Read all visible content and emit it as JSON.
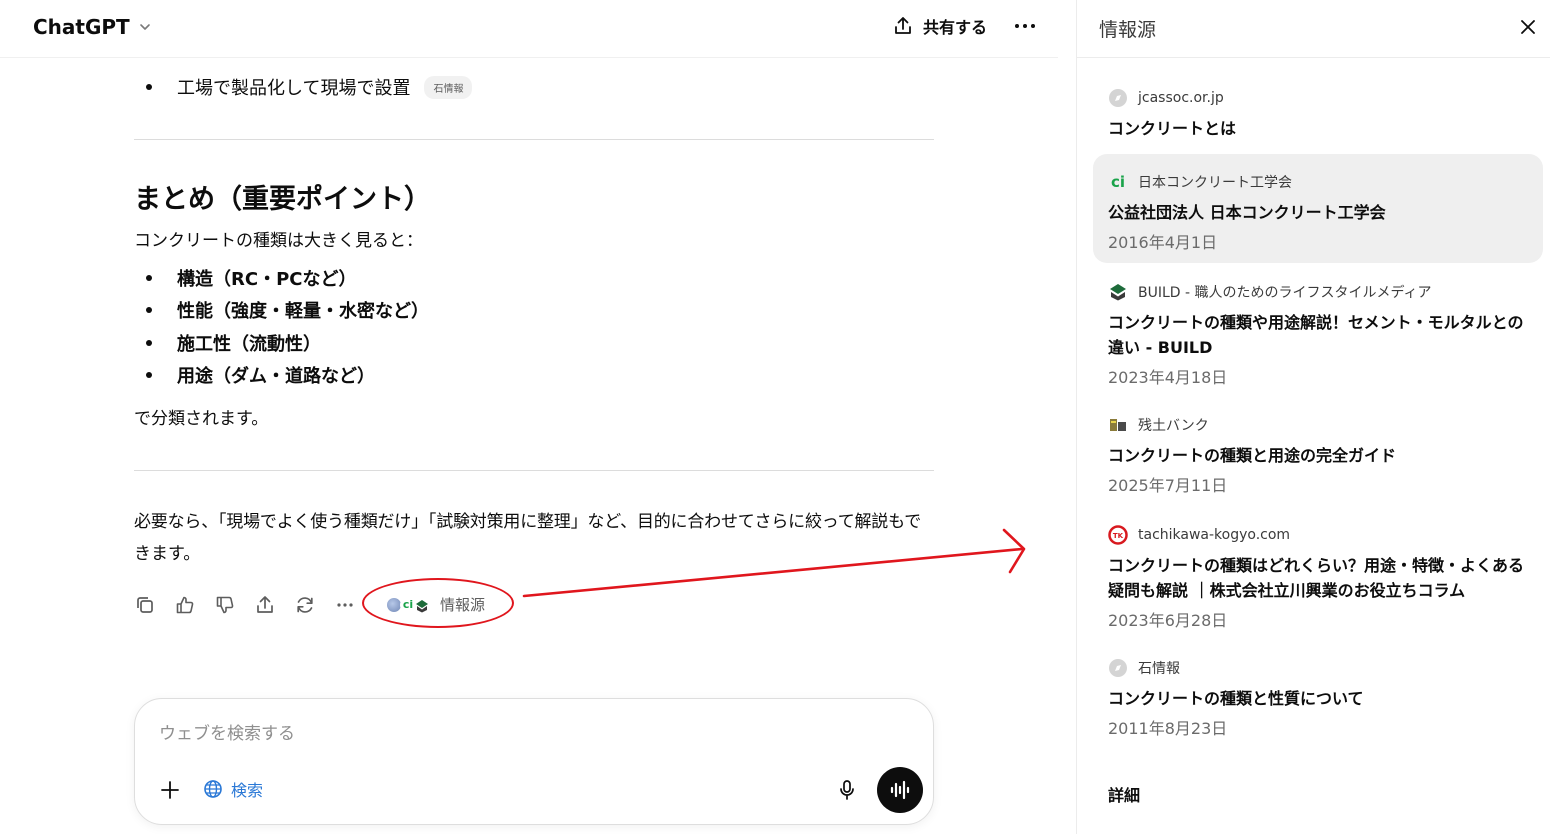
{
  "header": {
    "model_name": "ChatGPT",
    "share_label": "共有する"
  },
  "message": {
    "top_bullet": "工場で製品化して現場で設置",
    "top_bullet_chip": "石情報",
    "summary_heading": "まとめ（重要ポイント）",
    "summary_intro": "コンクリートの種類は大きく見ると：",
    "points": [
      {
        "bold": "構造",
        "rest": "（RC・PCなど）"
      },
      {
        "bold": "性能",
        "rest": "（強度・軽量・水密など）"
      },
      {
        "bold": "施工性",
        "rest": "（流動性）"
      },
      {
        "bold": "用途",
        "rest": "（ダム・道路など）"
      }
    ],
    "summary_outro": "で分類されます。",
    "closing_line1": "必要なら、「現場でよく使う種類だけ」「試験対策用に整理」など、目的に合わせてさらに絞って解説もで",
    "closing_line2": "きます。",
    "sources_label": "情報源"
  },
  "composer": {
    "placeholder": "ウェブを検索する",
    "search_label": "検索"
  },
  "panel": {
    "title": "情報源",
    "details_label": "詳細",
    "sources": [
      {
        "site": "jcassoc.or.jp",
        "title": "コンクリートとは",
        "date": "",
        "icon": "globe-icon"
      },
      {
        "site": "日本コンクリート工学会",
        "title": "公益社団法人 日本コンクリート工学会",
        "date": "2016年4月1日",
        "icon": "jci-logo-icon"
      },
      {
        "site": "BUILD - 職人のためのライフスタイルメディア",
        "title": "コンクリートの種類や用途解説！セメント・モルタルとの違い - BUILD",
        "date": "2023年4月18日",
        "icon": "build-logo-icon"
      },
      {
        "site": "残土バンク",
        "title": "コンクリートの種類と用途の完全ガイド",
        "date": "2025年7月11日",
        "icon": "zando-logo-icon"
      },
      {
        "site": "tachikawa-kogyo.com",
        "title": "コンクリートの種類はどれくらい？用途・特徴・よくある疑問も解説 ｜株式会社立川興業のお役立ちコラム",
        "date": "2023年6月28日",
        "icon": "tachikawa-logo-icon"
      },
      {
        "site": "石情報",
        "title": "コンクリートの種類と性質について",
        "date": "2011年8月23日",
        "icon": "globe-icon"
      }
    ]
  },
  "colors": {
    "annotation_red": "#e0161d",
    "search_blue": "#2a78d6",
    "jci_green": "#1aa34a"
  }
}
